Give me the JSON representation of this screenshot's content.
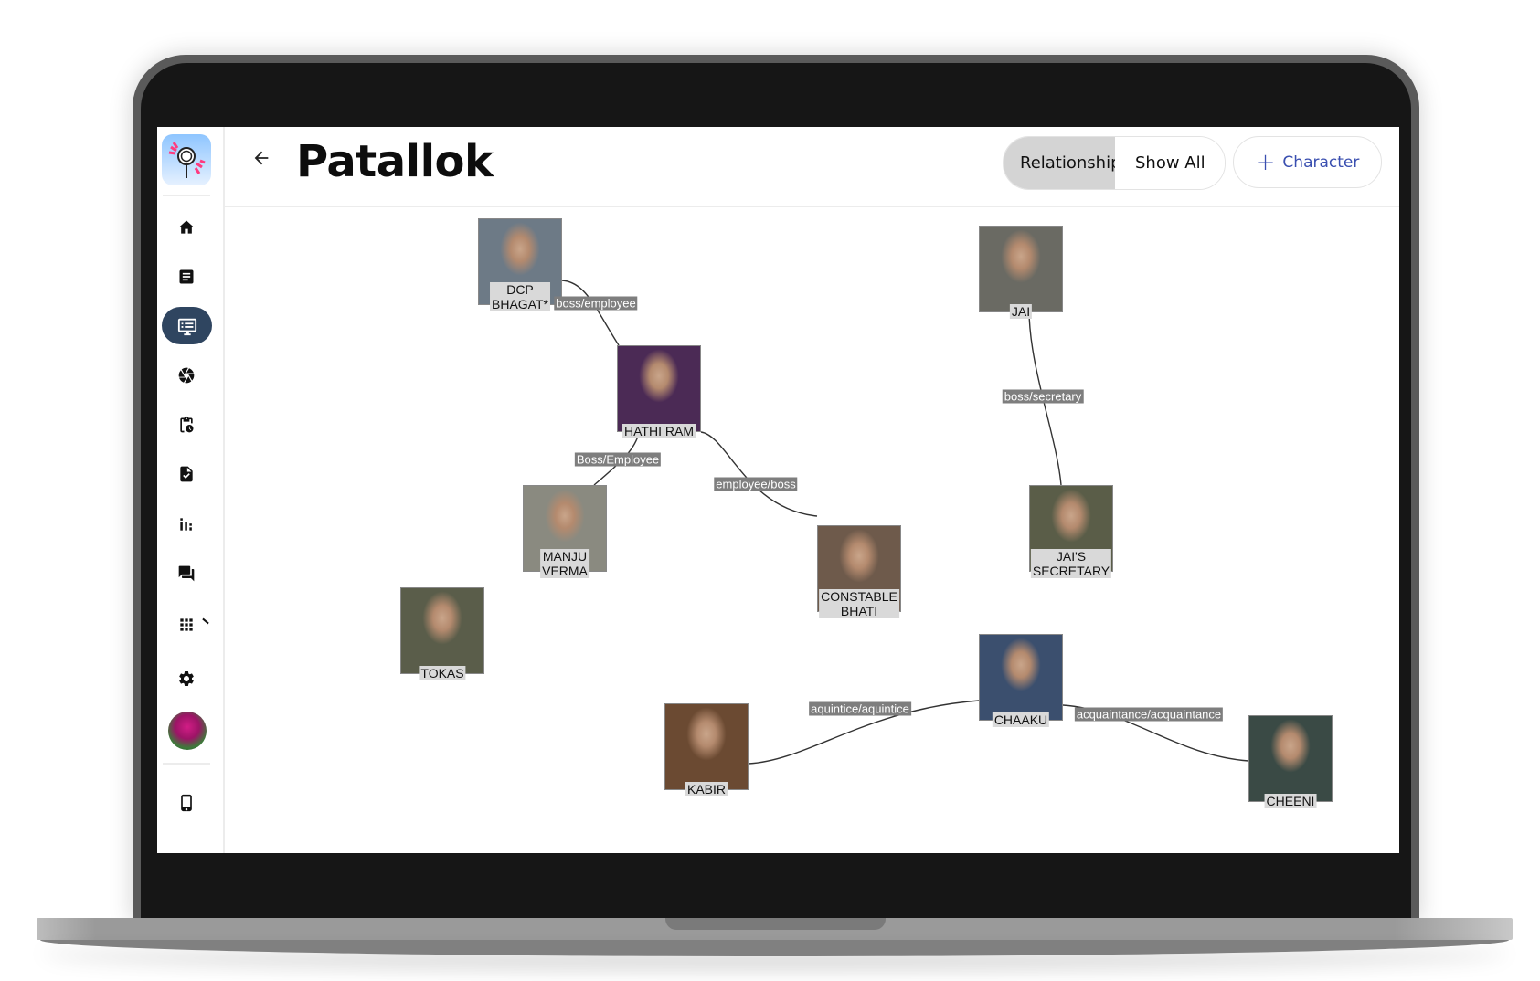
{
  "app": {
    "title": "Patallok",
    "back_label": "←"
  },
  "header": {
    "toggle": [
      {
        "label": "Relationship",
        "active": true
      },
      {
        "label": "Show All",
        "active": false
      }
    ],
    "add_character": {
      "icon": "+",
      "label": "Character"
    },
    "accent_color": "#3a4fb0"
  },
  "sidebar": {
    "items": [
      {
        "icon": "home-icon",
        "active": false
      },
      {
        "icon": "document-icon",
        "active": false
      },
      {
        "icon": "monitor-list-icon",
        "active": true
      },
      {
        "icon": "aperture-icon",
        "active": false
      },
      {
        "icon": "clipboard-clock-icon",
        "active": false
      },
      {
        "icon": "file-check-icon",
        "active": false
      },
      {
        "icon": "bar-chart-icon",
        "active": false
      },
      {
        "icon": "forum-icon",
        "active": false
      },
      {
        "icon": "apps-grid-icon",
        "active": false
      },
      {
        "icon": "gear-icon",
        "active": false
      }
    ],
    "active_color": "#2f4560",
    "bottom_icon": "phone-icon"
  },
  "graph": {
    "nodes": [
      {
        "id": "dcp",
        "label": "DCP\nBHAGAT*",
        "photo_bg": "#6d7a86"
      },
      {
        "id": "hathi",
        "label": "HATHI RAM",
        "photo_bg": "#4b2a55"
      },
      {
        "id": "jai",
        "label": "JAI",
        "photo_bg": "#6a6a63"
      },
      {
        "id": "manju",
        "label": "MANJU\nVERMA",
        "photo_bg": "#8a8a80"
      },
      {
        "id": "bhati",
        "label": "CONSTABLE\nBHATI",
        "photo_bg": "#6e5a4b"
      },
      {
        "id": "secretary",
        "label": "JAI'S\nSECRETARY",
        "photo_bg": "#5a5d48"
      },
      {
        "id": "tokas",
        "label": "TOKAS",
        "photo_bg": "#5a5d4a"
      },
      {
        "id": "chaaku",
        "label": "CHAAKU",
        "photo_bg": "#3b4f6e"
      },
      {
        "id": "kabir",
        "label": "KABIR",
        "photo_bg": "#6b4a32"
      },
      {
        "id": "cheeni",
        "label": "CHEENI",
        "photo_bg": "#3a4a45"
      }
    ],
    "edges": [
      {
        "from": "dcp",
        "to": "hathi",
        "label": "boss/employee"
      },
      {
        "from": "hathi",
        "to": "manju",
        "label": "Boss/Employee"
      },
      {
        "from": "hathi",
        "to": "bhati",
        "label": "employee/boss"
      },
      {
        "from": "jai",
        "to": "secretary",
        "label": "boss/secretary"
      },
      {
        "from": "kabir",
        "to": "chaaku",
        "label": "aquintice/aquintice"
      },
      {
        "from": "chaaku",
        "to": "cheeni",
        "label": "acquaintance/acquaintance"
      }
    ]
  }
}
